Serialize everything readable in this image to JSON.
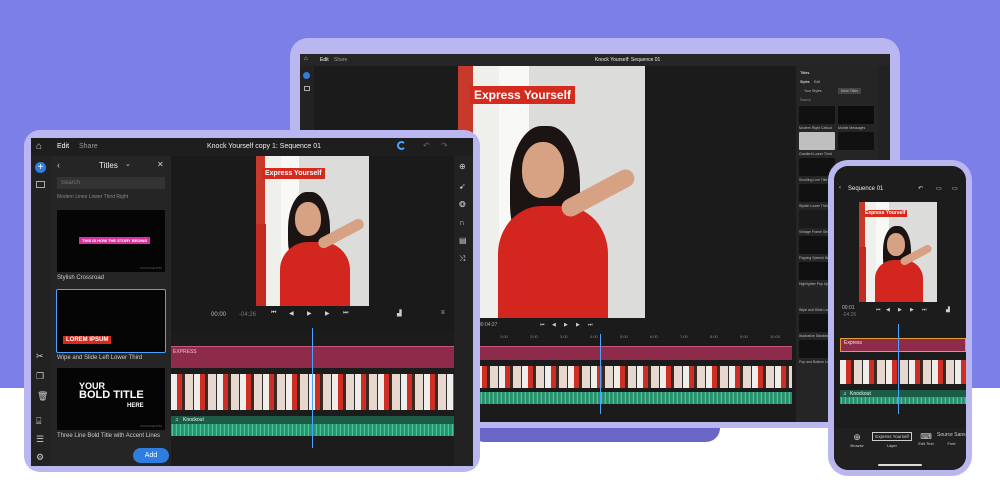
{
  "laptop": {
    "tabs": [
      "Edit",
      "Share"
    ],
    "sequence_title": "Knock Yourself: Sequence 01",
    "title_overlay": "Express Yourself",
    "timecode": "00:04:27",
    "panel": {
      "title": "Titles",
      "tabs": [
        "Styles",
        "Edit"
      ],
      "sub_tabs": [
        "Your Styles",
        "More Titles"
      ],
      "search": "Search",
      "items": [
        "Modern Right Callout",
        "Mobile Messages",
        "Gradient Lower Third",
        "Scrolling Line Title",
        "Stylish Lower Third",
        "Vintage Frame Stroke",
        "Flipping Speech Bubble",
        "Highlighter Pop Up",
        "Wipe and Slide Lower",
        "Illustrative Stacked",
        "Pop and Bottom Lower"
      ]
    },
    "tracks": {
      "title": "Express",
      "audio": "Knockout"
    },
    "ruler": [
      "1:00",
      "2:00",
      "3:00",
      "4:00",
      "5:00",
      "6:00",
      "7:00",
      "8:00",
      "9:00",
      "10:00"
    ],
    "icons": [
      "home-icon",
      "titles-icon",
      "add-icon",
      "undo-icon",
      "redo-icon"
    ]
  },
  "tablet": {
    "tabs": [
      "Edit",
      "Share"
    ],
    "sequence_title": "Knock Yourself copy 1: Sequence 01",
    "panel_title": "Titles",
    "search_placeholder": "Search",
    "top_cut_label": "Modern Lines Lower Third Right",
    "cards": [
      {
        "label": "Stylish Crossroad",
        "thumb_text": "THIS IS HOW THE STORY BEGINS",
        "thumb_sub": "FOOTAGE.PNG"
      },
      {
        "label": "Wipe and Slide Left Lower Third",
        "thumb_text": "LOREM IPSUM",
        "thumb_sub": ""
      },
      {
        "label": "Three Line Bold Title with Accent Lines",
        "thumb_text_1": "YOUR",
        "thumb_text_2": "BOLD TITLE",
        "thumb_text_3": "HERE",
        "thumb_sub": "FOOTAGE.PNG"
      }
    ],
    "add_button": "Add",
    "title_overlay": "Express Yourself",
    "timecode_current": "00:00",
    "timecode_total": "-04:26",
    "tracks": {
      "title": "EXPRESS",
      "audio": "Knockout"
    },
    "icons": [
      "home-icon",
      "add-icon",
      "media-icon",
      "cut-icon",
      "copy-icon",
      "delete-icon",
      "tools-icon",
      "list-icon",
      "settings-icon"
    ]
  },
  "phone": {
    "sequence_title": "Sequence 01",
    "title_overlay": "Express Yourself",
    "timecode_current": "00:01",
    "timecode_total": "-04:26",
    "tracks": {
      "title": "Express",
      "audio": "Knockout"
    },
    "bottom_tools": [
      {
        "label": "Browse",
        "value": ""
      },
      {
        "label": "Layer",
        "value": "Express Yourself"
      },
      {
        "label": "Edit Text",
        "value": ""
      },
      {
        "label": "Font",
        "value": "Source Sans P"
      }
    ]
  },
  "colors": {
    "background": "#7c7fe8",
    "accent": "#4ea2ff",
    "title_red": "#d52b1e",
    "title_track": "#8e2b4a",
    "audio": "#3fb98c"
  }
}
